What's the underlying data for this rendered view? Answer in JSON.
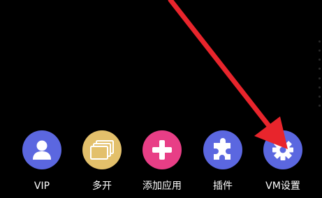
{
  "dock": {
    "items": [
      {
        "label": "VIP",
        "icon": "user-icon",
        "color": "#5b67e0"
      },
      {
        "label": "多开",
        "icon": "stacked-windows-icon",
        "color": "#e3c06b"
      },
      {
        "label": "添加应用",
        "icon": "plus-icon",
        "color": "#e83e86"
      },
      {
        "label": "插件",
        "icon": "puzzle-piece-icon",
        "color": "#5b67e0"
      },
      {
        "label": "VM设置",
        "icon": "gear-icon",
        "color": "#5b67e0"
      }
    ]
  },
  "annotation": {
    "arrow_color": "#e8252c",
    "target": "VM设置"
  }
}
